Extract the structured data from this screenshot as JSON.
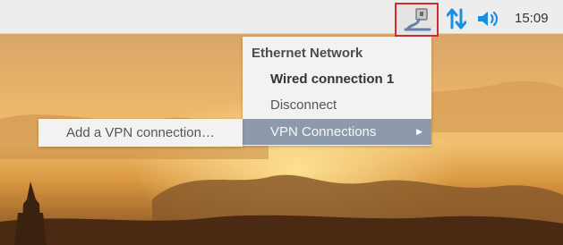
{
  "taskbar": {
    "clock": "15:09",
    "icons": [
      "network-icon",
      "transfer-arrows-icon",
      "volume-icon"
    ],
    "accent_color": "#1a8ee0",
    "highlight_border_color": "#d22b2b"
  },
  "network_menu": {
    "header": "Ethernet Network",
    "wired_connection": "Wired connection 1",
    "disconnect": "Disconnect",
    "vpn_connections": "VPN Connections",
    "vpn_submenu": {
      "add_vpn": "Add a VPN connection…"
    },
    "highlight_color": "#8e9aac"
  },
  "wallpaper": {
    "description_colors": [
      "#f0c070",
      "#7a4a20"
    ]
  }
}
